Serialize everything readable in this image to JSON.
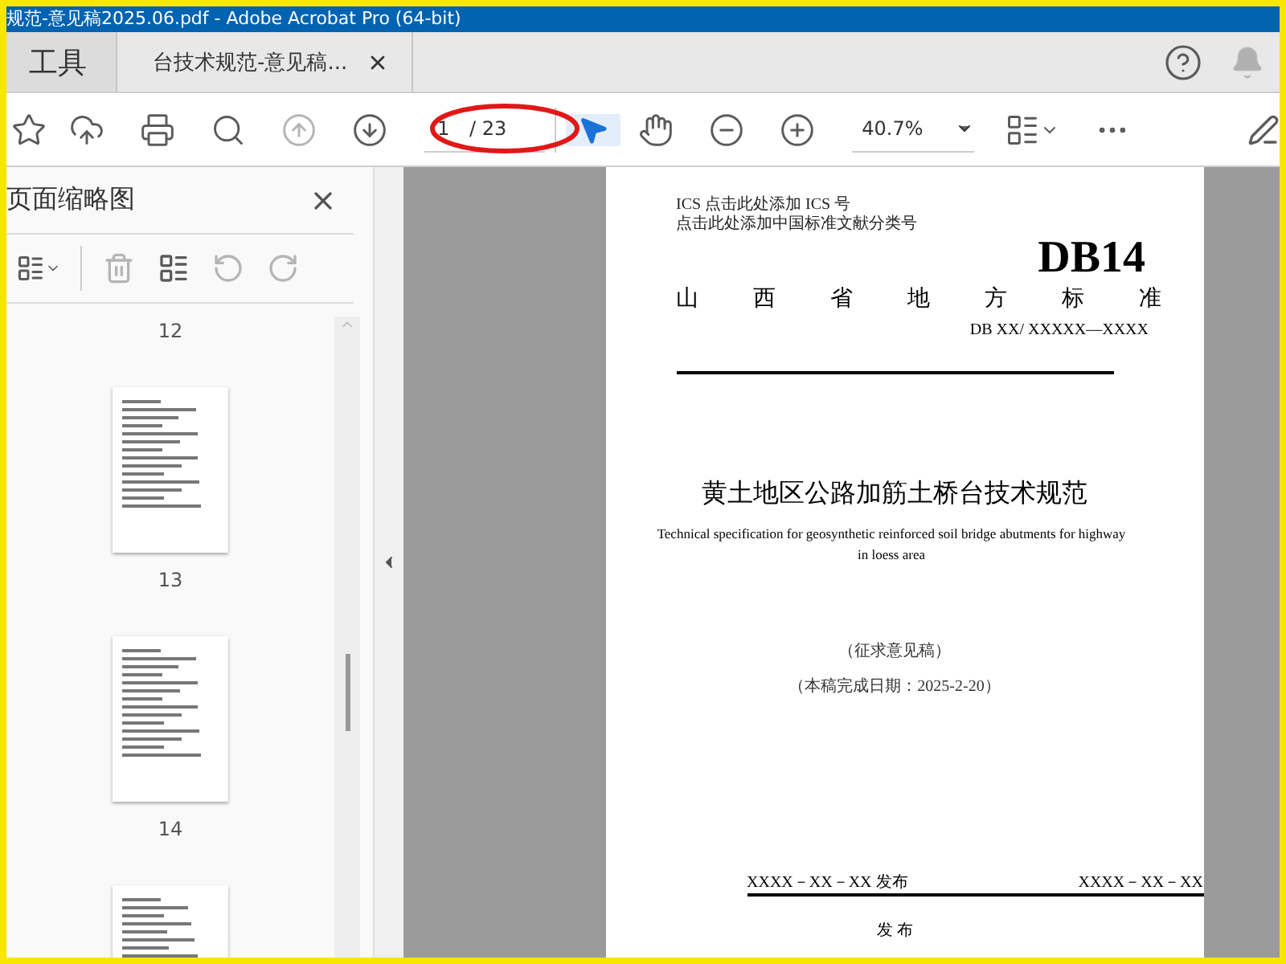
{
  "window": {
    "title": "规范-意见稿2025.06.pdf - Adobe Acrobat Pro (64-bit)"
  },
  "tabs": [
    {
      "label": "工具",
      "selected": false
    },
    {
      "label": "台技术规范-意见稿...",
      "selected": true
    }
  ],
  "toolbar": {
    "previous_page_disabled": true,
    "page_field": {
      "value": "1",
      "total": "/ 23"
    },
    "tools": [
      {
        "selected": true
      },
      {
        "selected": false
      }
    ],
    "zoom_field": {
      "value": "40.7%"
    }
  },
  "annotation": {
    "kind": "ellipse"
  },
  "thumbnail_panel": {
    "title": "页面缩略图",
    "delete_disabled": true,
    "rotate_disabled": true,
    "pages": [
      "12",
      "13",
      "14"
    ]
  },
  "document_page": {
    "header_lines": [
      "ICS 点击此处添加 ICS 号",
      "点击此处添加中国标准文献分类号"
    ],
    "code": "DB14",
    "category": "山西省地方标准",
    "number": "DB XX/ XXXXX—XXXX",
    "title": "黄土地区公路加筋土桥台技术规范",
    "english_title": "Technical specification for geosynthetic reinforced soil bridge abutments for highway in loess area",
    "draft_note": "（征求意见稿）",
    "completion_date": "（本稿完成日期：2025-2-20）",
    "issue_date": "XXXX－XX－XX 发布",
    "effective_date": "XXXX－XX－XX",
    "issuer": "发 布"
  }
}
